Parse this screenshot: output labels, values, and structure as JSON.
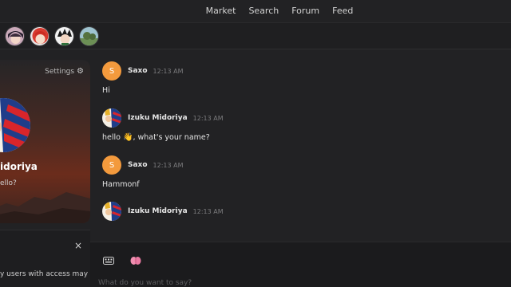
{
  "nav": {
    "links": [
      "Market",
      "Search",
      "Forum",
      "Feed"
    ]
  },
  "avatar_strip": {
    "icons": [
      "avatar-dark-hair",
      "avatar-red-hair",
      "avatar-spiky-hair",
      "avatar-landscape"
    ]
  },
  "profile_card": {
    "settings_label": "Settings",
    "name": "idoriya",
    "status": "ello?"
  },
  "left_panel": {
    "close_label": "×",
    "access_text": "y users with access may"
  },
  "messages": [
    {
      "author": "Saxo",
      "time": "12:13 AM",
      "text": "Hi",
      "avatar_letter": "S",
      "avatar_kind": "letter"
    },
    {
      "author": "Izuku Midoriya",
      "time": "12:13 AM",
      "text": "hello",
      "text_suffix": ", what's your name?",
      "avatar_kind": "image"
    },
    {
      "author": "Saxo",
      "time": "12:13 AM",
      "text": "Hammonf",
      "avatar_letter": "S",
      "avatar_kind": "letter"
    },
    {
      "author": "Izuku Midoriya",
      "time": "12:13 AM",
      "text": "",
      "avatar_kind": "image"
    }
  ],
  "composer": {
    "placeholder": "What do you want to say?",
    "tools": [
      "keyboard-icon",
      "brain-icon"
    ]
  },
  "colors": {
    "accent_letter_avatar": "#f39a3d",
    "background": "#222224"
  }
}
